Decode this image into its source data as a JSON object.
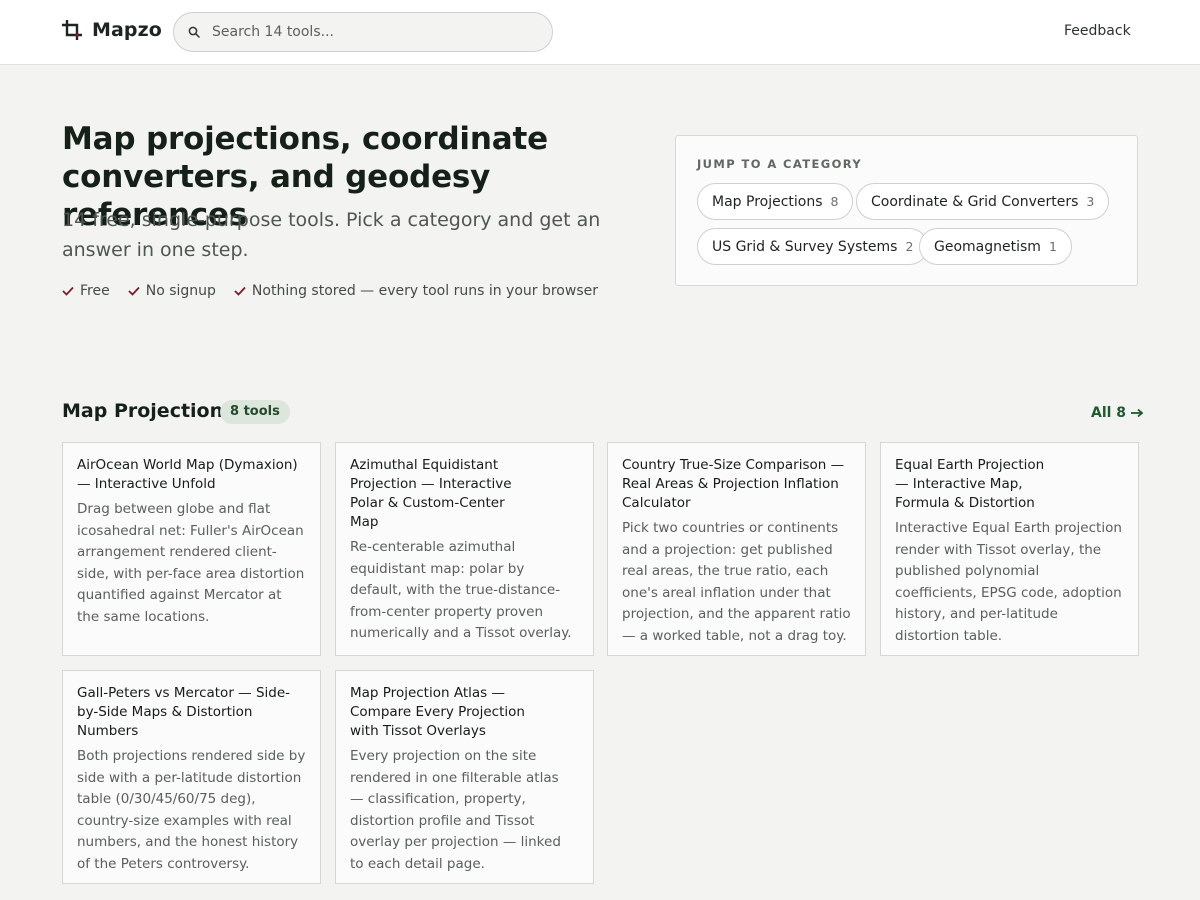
{
  "header": {
    "brand": "Mapzo",
    "search_placeholder": "Search 14 tools...",
    "feedback_label": "Feedback"
  },
  "hero": {
    "title": "Map projections, coordinate converters, and geodesy references",
    "subtitle": "14 free, single-purpose tools. Pick a category and get an answer in one step.",
    "checks": [
      "Free",
      "No signup",
      "Nothing stored — every tool runs in your browser"
    ]
  },
  "categories": {
    "label": "JUMP TO A CATEGORY",
    "items": [
      {
        "label": "Map Projections",
        "count": "8"
      },
      {
        "label": "Coordinate & Grid Converters",
        "count": "3"
      },
      {
        "label": "US Grid & Survey Systems",
        "count": "2"
      },
      {
        "label": "Geomagnetism",
        "count": "1"
      }
    ]
  },
  "section": {
    "title": "Map Projections",
    "badge": "8 tools",
    "all_link": "All 8"
  },
  "cards": [
    {
      "title": "AirOcean World Map (Dymaxion) — Interactive Unfold",
      "desc": "Drag between globe and flat icosahedral net: Fuller's AirOcean arrangement rendered client-side, with per-face area distortion quantified against Mercator at the same locations."
    },
    {
      "title": "Azimuthal Equidistant Projection — Interactive Polar & Custom-Center Map",
      "desc": "Re-centerable azimuthal equidistant map: polar by default, with the true-distance-from-center property proven numerically and a Tissot overlay."
    },
    {
      "title": "Country True-Size Comparison — Real Areas & Projection Inflation Calculator",
      "desc": "Pick two countries or continents and a projection: get published real areas, the true ratio, each one's areal inflation under that projection, and the apparent ratio — a worked table, not a drag toy."
    },
    {
      "title": "Equal Earth Projection — Interactive Map, Formula & Distortion",
      "desc": "Interactive Equal Earth projection render with Tissot overlay, the published polynomial coefficients, EPSG code, adoption history, and per-latitude distortion table."
    },
    {
      "title": "Gall-Peters vs Mercator — Side-by-Side Maps & Distortion Numbers",
      "desc": "Both projections rendered side by side with a per-latitude distortion table (0/30/45/60/75 deg), country-size examples with real numbers, and the honest history of the Peters controversy."
    },
    {
      "title": "Map Projection Atlas — Compare Every Projection with Tissot Overlays",
      "desc": "Every projection on the site rendered in one filterable atlas — classification, property, distortion profile and Tissot overlay per projection — linked to each detail page."
    }
  ]
}
